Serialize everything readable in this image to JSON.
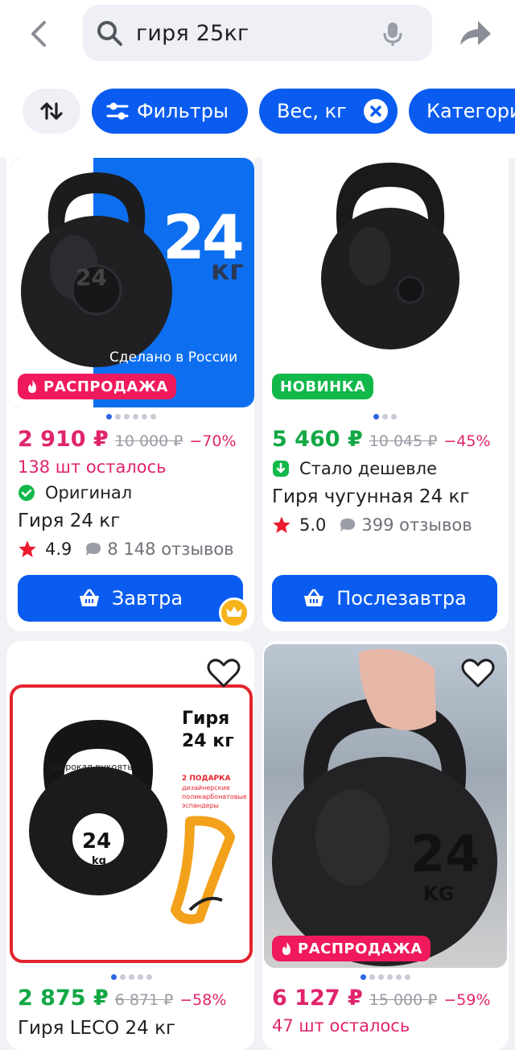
{
  "search": {
    "query": "гиря 25кг"
  },
  "chips": {
    "filters": "Фильтры",
    "weight": "Вес, кг",
    "category": "Категори"
  },
  "products": [
    {
      "image_text": {
        "big": "24",
        "unit": "кг",
        "made": "Сделано в России",
        "number": "24"
      },
      "badge": "РАСПРОДАЖА",
      "price": "2 910 ₽",
      "old_price": "10 000 ₽",
      "discount": "−70%",
      "stock": "138 шт осталось",
      "tag": "Оригинал",
      "title": "Гиря 24 кг",
      "rating": "4.9",
      "reviews": "8 148 отзывов",
      "button": "Завтра"
    },
    {
      "badge": "НОВИНКА",
      "price": "5 460 ₽",
      "old_price": "10 045 ₽",
      "discount": "−45%",
      "tag": "Стало дешевле",
      "title": "Гиря чугунная 24 кг",
      "rating": "5.0",
      "reviews": "399 отзывов",
      "button": "Послезавтра"
    },
    {
      "image_text": {
        "title1": "Гиря",
        "title2": "24 кг",
        "handle": "широкая рукоять",
        "gift1": "2 ПОДАРКА",
        "gift2": "дизайнерские",
        "gift3": "поликарбонатовые",
        "gift4": "эспандеры",
        "number": "24",
        "unit": "kg"
      },
      "price": "2 875 ₽",
      "old_price": "6 871 ₽",
      "discount": "−58%",
      "title": "Гиря LECO 24 кг"
    },
    {
      "image_text": {
        "number": "24",
        "unit": "KG"
      },
      "badge": "РАСПРОДАЖА",
      "price": "6 127 ₽",
      "old_price": "15 000 ₽",
      "discount": "−59%",
      "stock": "47 шт осталось"
    }
  ],
  "colors": {
    "accent": "#0a5cf0",
    "price": "#e0246c",
    "sale": "#f0195c",
    "new": "#12b84a"
  }
}
